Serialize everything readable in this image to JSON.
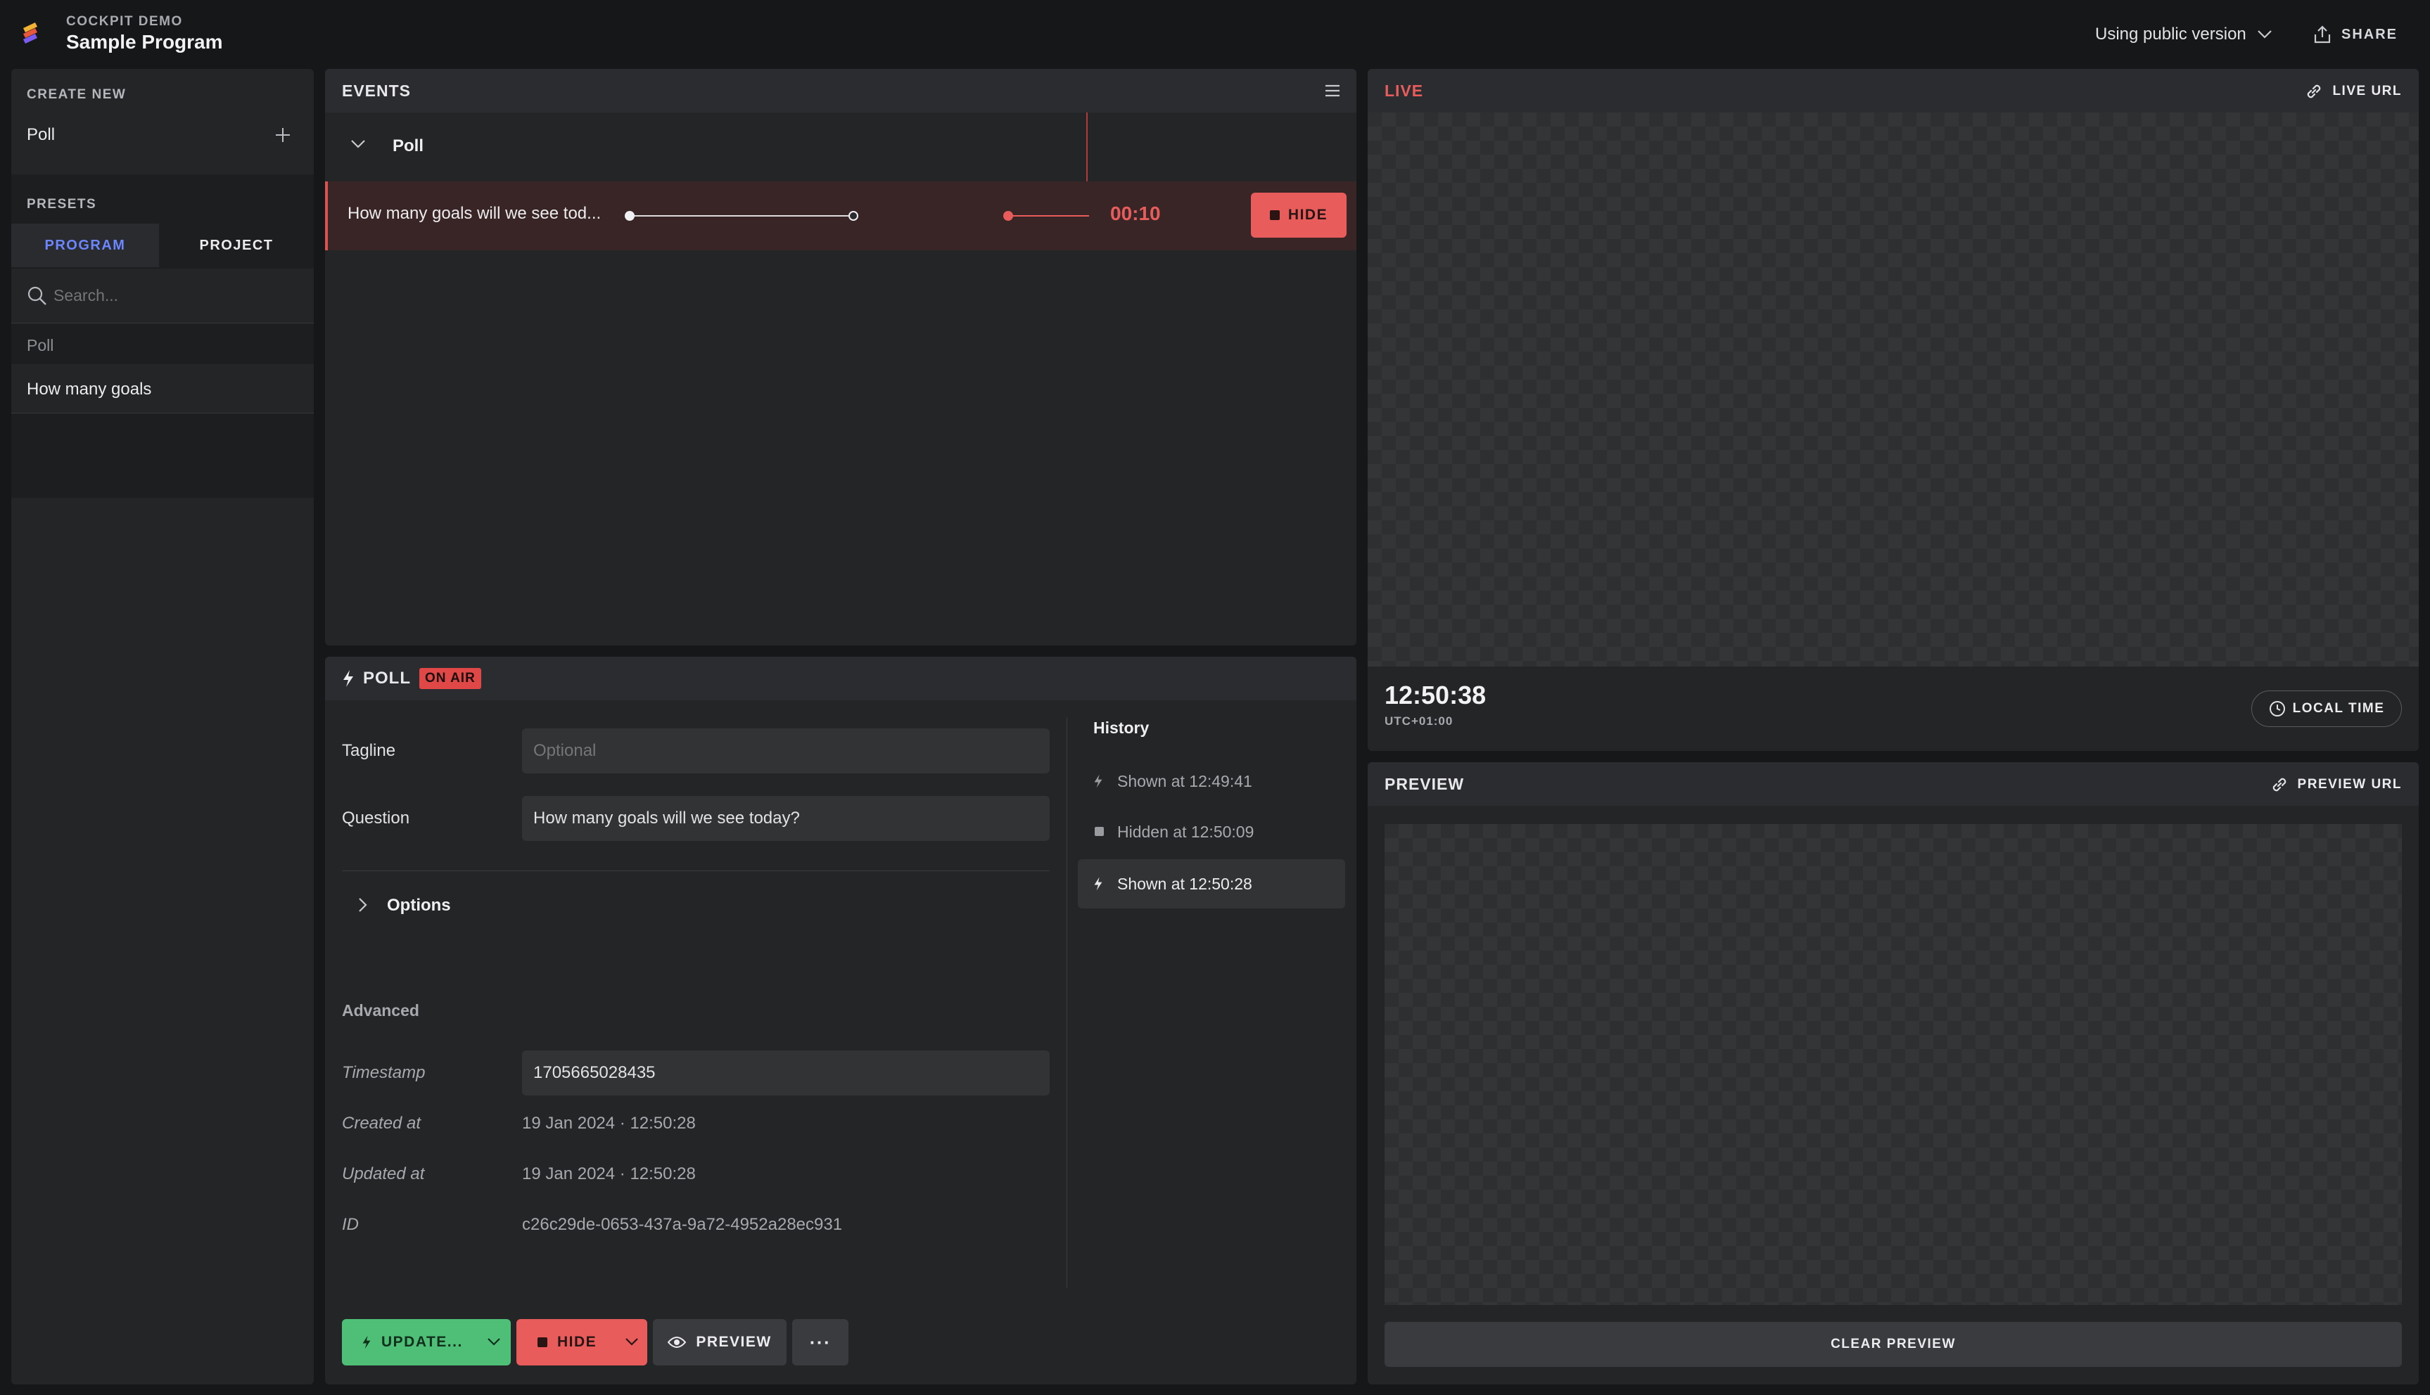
{
  "app": {
    "org": "COCKPIT DEMO",
    "program": "Sample Program",
    "version_label": "Using public version",
    "share_label": "SHARE"
  },
  "sidebar": {
    "create_new_heading": "CREATE NEW",
    "create_item": "Poll",
    "presets_heading": "PRESETS",
    "tabs": [
      "PROGRAM",
      "PROJECT"
    ],
    "search_placeholder": "Search...",
    "group_label": "Poll",
    "preset_item": "How many goals"
  },
  "events": {
    "title": "EVENTS",
    "group": "Poll",
    "row": {
      "text": "How many goals will we see tod...",
      "timer": "00:10",
      "hide_label": "HIDE"
    }
  },
  "editor": {
    "title": "POLL",
    "badge": "ON AIR",
    "tagline_label": "Tagline",
    "tagline_placeholder": "Optional",
    "question_label": "Question",
    "question_value": "How many goals will we see today?",
    "options_label": "Options",
    "advanced_label": "Advanced",
    "timestamp_label": "Timestamp",
    "timestamp_value": "1705665028435",
    "created_label": "Created at",
    "created_value": "19 Jan 2024 · 12:50:28",
    "updated_label": "Updated at",
    "updated_value": "19 Jan 2024 · 12:50:28",
    "id_label": "ID",
    "id_value": "c26c29de-0653-437a-9a72-4952a28ec931",
    "history_title": "History",
    "history": [
      "Shown at 12:49:41",
      "Hidden at 12:50:09",
      "Shown at 12:50:28"
    ],
    "actions": {
      "update": "UPDATE...",
      "hide": "HIDE",
      "preview": "PREVIEW",
      "more": "···"
    }
  },
  "live": {
    "title": "LIVE",
    "url_label": "LIVE URL",
    "clock": "12:50:38",
    "tz": "UTC+01:00",
    "local_time_label": "LOCAL TIME"
  },
  "preview": {
    "title": "PREVIEW",
    "url_label": "PREVIEW URL",
    "clear_label": "CLEAR PREVIEW"
  },
  "colors": {
    "accent_blue": "#6b86ff",
    "danger": "#e85c5c",
    "success": "#4fbf78"
  }
}
